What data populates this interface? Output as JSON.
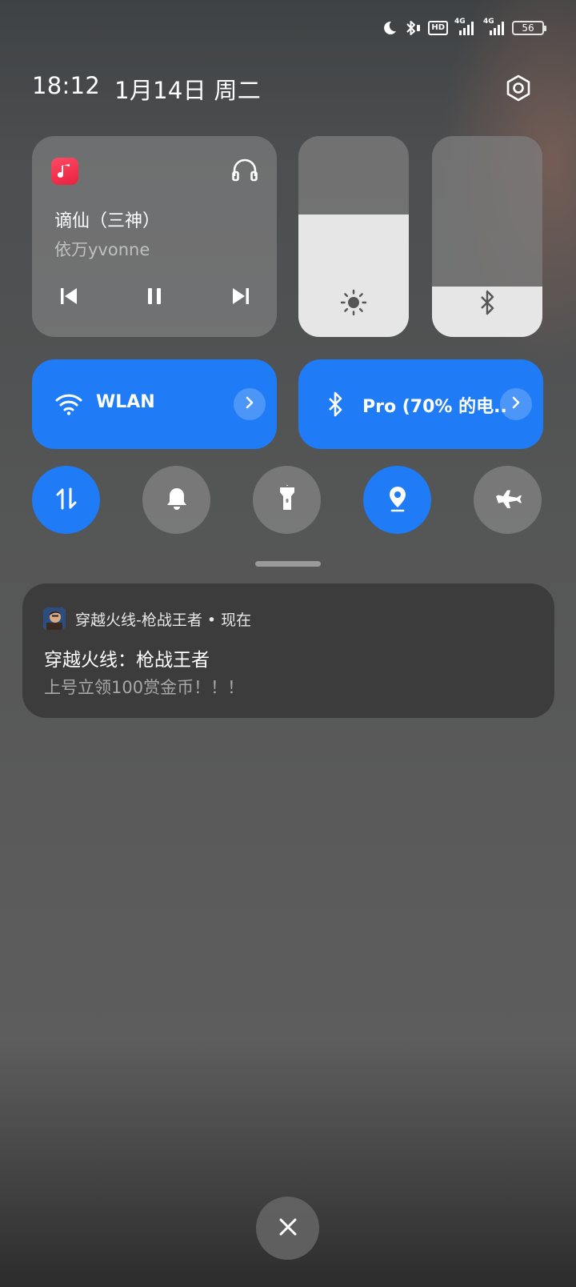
{
  "status_bar": {
    "network_tag_1": "4G",
    "network_tag_2": "4G",
    "hd_label": "HD",
    "battery_level": "56",
    "icons": [
      "moon-icon",
      "bluetooth-vibrate-icon",
      "hd-voice-icon",
      "signal-icon",
      "signal-icon",
      "battery-icon"
    ]
  },
  "header": {
    "time": "18:12",
    "date": "1月14日 周二",
    "settings_icon": "gear-icon"
  },
  "media": {
    "title": "谪仙（三神）",
    "artist": "依万yvonne",
    "app_icon": "music-note-icon",
    "output_icon": "headphones-icon",
    "controls": [
      "skip-previous-icon",
      "pause-icon",
      "skip-next-icon"
    ]
  },
  "sliders": {
    "brightness": {
      "level": 0.61,
      "icon": "sun-icon"
    },
    "bluetooth_volume": {
      "level": 0.25,
      "icon": "bluetooth-icon"
    }
  },
  "tiles": {
    "wlan": {
      "label": "WLAN",
      "icon": "wifi-icon",
      "state": "on"
    },
    "bluetooth": {
      "label": "Pro (70% 的电..",
      "icon": "bluetooth-icon",
      "state": "on"
    }
  },
  "toggles": [
    {
      "name": "mobile-data",
      "icon": "data-arrows-icon",
      "state": "on"
    },
    {
      "name": "ringer",
      "icon": "bell-icon",
      "state": "off"
    },
    {
      "name": "flashlight",
      "icon": "flashlight-icon",
      "state": "off"
    },
    {
      "name": "location",
      "icon": "location-pin-icon",
      "state": "on"
    },
    {
      "name": "airplane-mode",
      "icon": "airplane-icon",
      "state": "off"
    }
  ],
  "notification": {
    "app_name_time": "穿越火线-枪战王者 • 现在",
    "title": "穿越火线：枪战王者",
    "body": "上号立领100赏金币！！！"
  },
  "colors": {
    "accent": "#1f7cf6",
    "music_app": "#f0304c",
    "slider_fill": "#e6e6e6"
  }
}
